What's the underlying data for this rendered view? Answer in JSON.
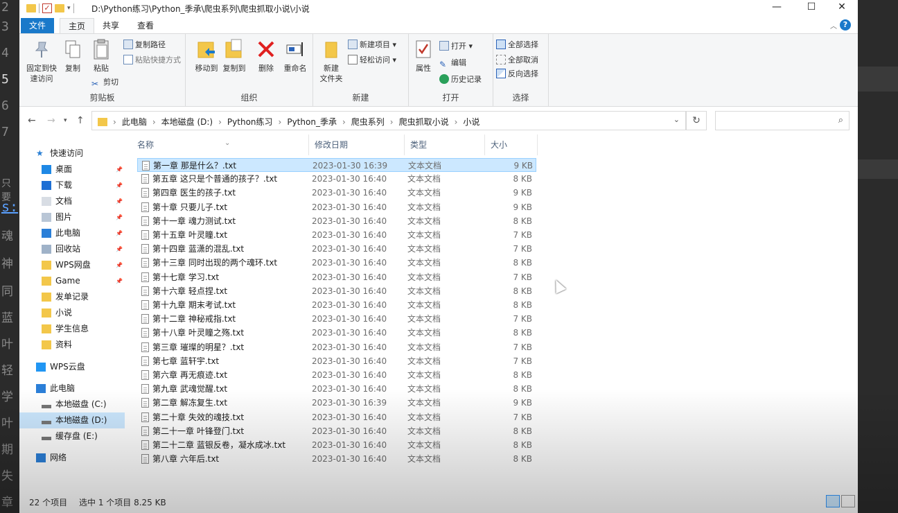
{
  "background_editor": {
    "line_numbers": [
      "2",
      "3",
      "4",
      "5",
      "6",
      "7"
    ],
    "side_chars": [
      "只要",
      "s:",
      "魂",
      "神",
      "同",
      "蓝",
      "叶",
      "轻",
      "学",
      "叶",
      "期",
      "失",
      "章"
    ]
  },
  "window": {
    "path_title": "D:\\Python练习\\Python_季承\\爬虫系列\\爬虫抓取小说\\小说",
    "controls": {
      "minimize": "—",
      "maximize": "☐",
      "close": "✕"
    }
  },
  "ribbon_tabs": [
    "文件",
    "主页",
    "共享",
    "查看"
  ],
  "ribbon": {
    "clipboard": {
      "label": "剪贴板",
      "pin_quick_access": "固定到快\n速访问",
      "copy": "复制",
      "paste": "粘贴",
      "copy_path": "复制路径",
      "paste_shortcut": "粘贴快捷方式",
      "cut": "剪切"
    },
    "organize": {
      "label": "组织",
      "move_to": "移动到",
      "copy_to": "复制到",
      "delete": "删除",
      "rename": "重命名"
    },
    "new": {
      "label": "新建",
      "new_folder": "新建\n文件夹",
      "new_item": "新建项目 ▾",
      "easy_access": "轻松访问 ▾"
    },
    "open": {
      "label": "打开",
      "properties": "属性",
      "open": "打开 ▾",
      "edit": "编辑",
      "history": "历史记录"
    },
    "select": {
      "label": "选择",
      "select_all": "全部选择",
      "select_none": "全部取消",
      "invert": "反向选择"
    }
  },
  "address": {
    "crumbs": [
      "此电脑",
      "本地磁盘 (D:)",
      "Python练习",
      "Python_季承",
      "爬虫系列",
      "爬虫抓取小说",
      "小说"
    ],
    "search_placeholder": ""
  },
  "nav_pane": [
    {
      "label": "快速访问",
      "icon": "star-icon",
      "pinned": false
    },
    {
      "label": "桌面",
      "icon": "desktop-icon",
      "pinned": true
    },
    {
      "label": "下载",
      "icon": "download-icon",
      "pinned": true
    },
    {
      "label": "文档",
      "icon": "document-icon",
      "pinned": true
    },
    {
      "label": "图片",
      "icon": "picture-icon",
      "pinned": true
    },
    {
      "label": "此电脑",
      "icon": "computer-icon",
      "pinned": true
    },
    {
      "label": "回收站",
      "icon": "recycle-bin-icon",
      "pinned": true
    },
    {
      "label": "WPS网盘",
      "icon": "folder-icon",
      "pinned": true
    },
    {
      "label": "Game",
      "icon": "folder-icon",
      "pinned": true
    },
    {
      "label": "发单记录",
      "icon": "folder-icon",
      "pinned": false
    },
    {
      "label": "小说",
      "icon": "folder-icon",
      "pinned": false
    },
    {
      "label": "学生信息",
      "icon": "folder-icon",
      "pinned": false
    },
    {
      "label": "资料",
      "icon": "folder-icon",
      "pinned": false
    },
    {
      "label": "WPS云盘",
      "icon": "cloud-icon",
      "pinned": false
    },
    {
      "label": "此电脑",
      "icon": "computer-icon",
      "pinned": false
    },
    {
      "label": "本地磁盘 (C:)",
      "icon": "drive-icon",
      "pinned": false
    },
    {
      "label": "本地磁盘 (D:)",
      "icon": "drive-icon",
      "pinned": false
    },
    {
      "label": "缓存盘 (E:)",
      "icon": "drive-icon",
      "pinned": false
    },
    {
      "label": "网络",
      "icon": "network-icon",
      "pinned": false
    }
  ],
  "columns": [
    "名称",
    "修改日期",
    "类型",
    "大小"
  ],
  "files": [
    {
      "name": "第一章 那是什么？.txt",
      "date": "2023-01-30 16:39",
      "type": "文本文档",
      "size": "9 KB"
    },
    {
      "name": "第五章 这只是个普通的孩子？.txt",
      "date": "2023-01-30 16:40",
      "type": "文本文档",
      "size": "8 KB"
    },
    {
      "name": "第四章 医生的孩子.txt",
      "date": "2023-01-30 16:40",
      "type": "文本文档",
      "size": "9 KB"
    },
    {
      "name": "第十章 只要儿子.txt",
      "date": "2023-01-30 16:40",
      "type": "文本文档",
      "size": "9 KB"
    },
    {
      "name": "第十一章 魂力测试.txt",
      "date": "2023-01-30 16:40",
      "type": "文本文档",
      "size": "8 KB"
    },
    {
      "name": "第十五章 叶灵瞳.txt",
      "date": "2023-01-30 16:40",
      "type": "文本文档",
      "size": "7 KB"
    },
    {
      "name": "第十四章 蓝潇的混乱.txt",
      "date": "2023-01-30 16:40",
      "type": "文本文档",
      "size": "7 KB"
    },
    {
      "name": "第十三章 同时出现的两个魂环.txt",
      "date": "2023-01-30 16:40",
      "type": "文本文档",
      "size": "8 KB"
    },
    {
      "name": "第十七章 学习.txt",
      "date": "2023-01-30 16:40",
      "type": "文本文档",
      "size": "7 KB"
    },
    {
      "name": "第十六章 轻点捏.txt",
      "date": "2023-01-30 16:40",
      "type": "文本文档",
      "size": "8 KB"
    },
    {
      "name": "第十九章 期末考试.txt",
      "date": "2023-01-30 16:40",
      "type": "文本文档",
      "size": "8 KB"
    },
    {
      "name": "第十二章 神秘戒指.txt",
      "date": "2023-01-30 16:40",
      "type": "文本文档",
      "size": "7 KB"
    },
    {
      "name": "第十八章 叶灵瞳之殇.txt",
      "date": "2023-01-30 16:40",
      "type": "文本文档",
      "size": "8 KB"
    },
    {
      "name": "第三章 璀璨的明星？.txt",
      "date": "2023-01-30 16:40",
      "type": "文本文档",
      "size": "7 KB"
    },
    {
      "name": "第七章 蓝轩宇.txt",
      "date": "2023-01-30 16:40",
      "type": "文本文档",
      "size": "7 KB"
    },
    {
      "name": "第六章 再无痕迹.txt",
      "date": "2023-01-30 16:40",
      "type": "文本文档",
      "size": "8 KB"
    },
    {
      "name": "第九章 武魂觉醒.txt",
      "date": "2023-01-30 16:40",
      "type": "文本文档",
      "size": "8 KB"
    },
    {
      "name": "第二章 解冻复生.txt",
      "date": "2023-01-30 16:39",
      "type": "文本文档",
      "size": "9 KB"
    },
    {
      "name": "第二十章 失效的魂技.txt",
      "date": "2023-01-30 16:40",
      "type": "文本文档",
      "size": "7 KB"
    },
    {
      "name": "第二十一章 叶锋登门.txt",
      "date": "2023-01-30 16:40",
      "type": "文本文档",
      "size": "8 KB"
    },
    {
      "name": "第二十二章 蓝银反卷，凝水成冰.txt",
      "date": "2023-01-30 16:40",
      "type": "文本文档",
      "size": "8 KB"
    },
    {
      "name": "第八章 六年后.txt",
      "date": "2023-01-30 16:40",
      "type": "文本文档",
      "size": "8 KB"
    }
  ],
  "status": {
    "item_count": "22 个项目",
    "selected": "选中 1 个项目  8.25 KB"
  },
  "colors": {
    "accent": "#1979ca",
    "selection": "#cce8ff",
    "folder": "#f3c74a"
  }
}
